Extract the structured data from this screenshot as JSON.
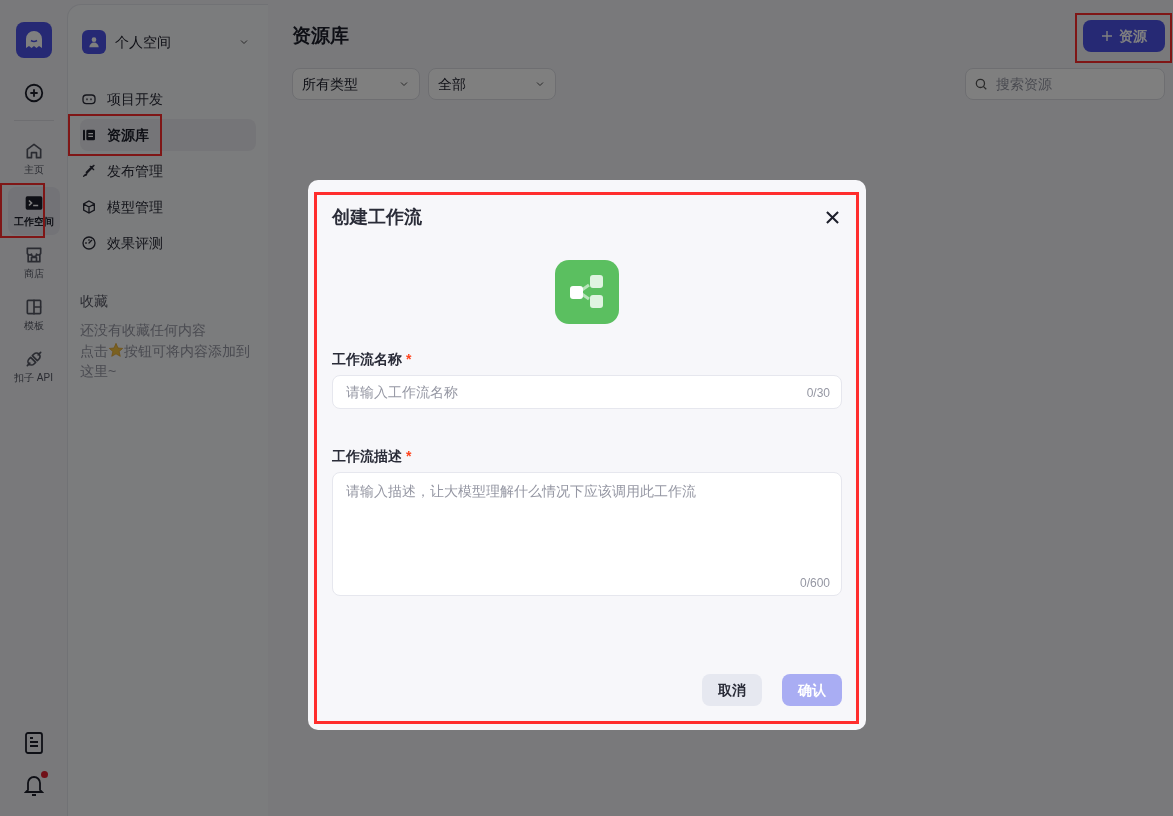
{
  "rail": {
    "items": [
      {
        "label": "主页",
        "selected": false,
        "highlighted": false
      },
      {
        "label": "工作空间",
        "selected": true,
        "highlighted": true
      },
      {
        "label": "商店",
        "selected": false,
        "highlighted": false
      },
      {
        "label": "模板",
        "selected": false,
        "highlighted": false
      },
      {
        "label": "扣子 API",
        "selected": false,
        "highlighted": false
      }
    ],
    "notifications_unread": true
  },
  "sidebar": {
    "workspace": "个人空间",
    "items": [
      {
        "label": "项目开发",
        "selected": false,
        "highlighted": false
      },
      {
        "label": "资源库",
        "selected": true,
        "highlighted": true
      },
      {
        "label": "发布管理",
        "selected": false,
        "highlighted": false
      },
      {
        "label": "模型管理",
        "selected": false,
        "highlighted": false
      },
      {
        "label": "效果评测",
        "selected": false,
        "highlighted": false
      }
    ],
    "favorites": {
      "title": "收藏",
      "empty_text": "还没有收藏任何内容",
      "hint_before": "点击",
      "hint_after": "按钮可将内容添加到",
      "hint_end": "这里~"
    }
  },
  "main": {
    "title": "资源库",
    "add_button": {
      "label": "资源",
      "highlighted": true
    },
    "filters": [
      "所有类型",
      "全部"
    ],
    "search": {
      "placeholder": "搜索资源"
    }
  },
  "dialog": {
    "title": "创建工作流",
    "highlighted": true,
    "fields": [
      {
        "kind": "input",
        "label": "工作流名称",
        "required_mark": "*",
        "placeholder": "请输入工作流名称",
        "counter": "0/30"
      },
      {
        "kind": "textarea",
        "label": "工作流描述",
        "required_mark": "*",
        "placeholder": "请输入描述，让大模型理解什么情况下应该调用此工作流",
        "counter": "0/600"
      }
    ],
    "cancel": "取消",
    "confirm": {
      "label": "确认",
      "disabled": true
    }
  }
}
